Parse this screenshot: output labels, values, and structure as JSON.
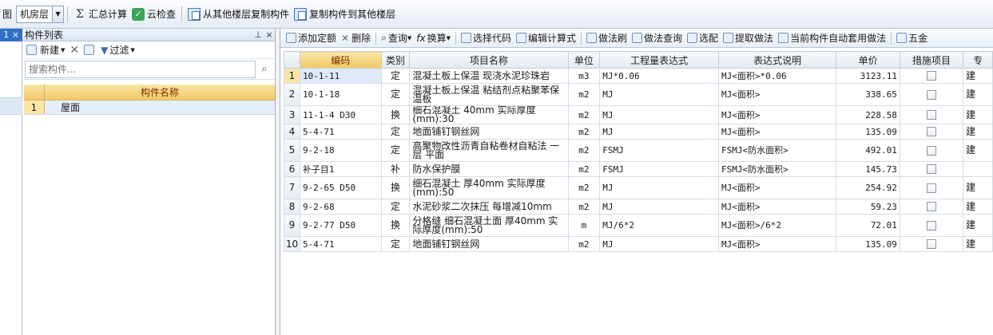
{
  "toolbar": {
    "prefix": "图",
    "floor": "机房层",
    "summary": "汇总计算",
    "cloud_check": "云检查",
    "copy_from_floor": "从其他楼层复制构件",
    "copy_to_floor": "复制构件到其他楼层"
  },
  "left_strip": {
    "tab": "1",
    "close": "×"
  },
  "component_panel": {
    "title": "构件列表",
    "pin": "ᵖ",
    "close": "×",
    "new_label": "新建",
    "filter_label": "过滤",
    "search_placeholder": "搜索构件...",
    "column_header": "构件名称",
    "rows": [
      {
        "index": "1",
        "name": "屋面"
      }
    ]
  },
  "items_toolbar": {
    "add_quota": "添加定额",
    "delete": "删除",
    "query": "查询",
    "convert": "换算",
    "select_code": "选择代码",
    "edit_formula": "编辑计算式",
    "method_brush": "做法刷",
    "method_query": "做法查询",
    "pick": "选配",
    "extract": "提取做法",
    "auto_apply": "当前构件自动套用做法",
    "five_gold": "五金"
  },
  "items_table": {
    "headers": [
      "编码",
      "类别",
      "项目名称",
      "单位",
      "工程量表达式",
      "表达式说明",
      "单价",
      "措施项目",
      "专"
    ],
    "rows": [
      {
        "no": "1",
        "code": "10-1-11",
        "type": "定",
        "name": "混凝土板上保温 现浇水泥珍珠岩",
        "unit": "m3",
        "expr": "MJ*0.06",
        "desc": "MJ<面积>*0.06",
        "price": "3123.11",
        "tail": "建"
      },
      {
        "no": "2",
        "code": "10-1-18",
        "type": "定",
        "name": "混凝土板上保温 粘结剂点粘聚苯保温板",
        "unit": "m2",
        "expr": "MJ",
        "desc": "MJ<面积>",
        "price": "338.65",
        "tail": "建"
      },
      {
        "no": "3",
        "code": "11-1-4 D30",
        "type": "换",
        "name": "细石混凝土 40mm 实际厚度(mm):30",
        "unit": "m2",
        "expr": "MJ",
        "desc": "MJ<面积>",
        "price": "228.58",
        "tail": "建"
      },
      {
        "no": "4",
        "code": "5-4-71",
        "type": "定",
        "name": "地面铺钉钢丝网",
        "unit": "m2",
        "expr": "MJ",
        "desc": "MJ<面积>",
        "price": "135.09",
        "tail": "建"
      },
      {
        "no": "5",
        "code": "9-2-18",
        "type": "定",
        "name": "高聚物改性沥青自粘卷材自粘法 一层 平面",
        "unit": "m2",
        "expr": "FSMJ",
        "desc": "FSMJ<防水面积>",
        "price": "492.01",
        "tail": "建"
      },
      {
        "no": "6",
        "code": "补子目1",
        "type": "补",
        "name": "防水保护膜",
        "unit": "m2",
        "expr": "FSMJ",
        "desc": "FSMJ<防水面积>",
        "price": "145.73",
        "tail": ""
      },
      {
        "no": "7",
        "code": "9-2-65 D50",
        "type": "换",
        "name": "细石混凝土 厚40mm 实际厚度(mm):50",
        "unit": "m2",
        "expr": "MJ",
        "desc": "MJ<面积>",
        "price": "254.92",
        "tail": "建"
      },
      {
        "no": "8",
        "code": "9-2-68",
        "type": "定",
        "name": "水泥砂浆二次抹压 每增减10mm",
        "unit": "m2",
        "expr": "MJ",
        "desc": "MJ<面积>",
        "price": "59.23",
        "tail": "建"
      },
      {
        "no": "9",
        "code": "9-2-77 D50",
        "type": "换",
        "name": "分格缝 细石混凝土面 厚40mm 实际厚度(mm):50",
        "unit": "m",
        "expr": "MJ/6*2",
        "desc": "MJ<面积>/6*2",
        "price": "72.01",
        "tail": "建"
      },
      {
        "no": "10",
        "code": "5-4-71",
        "type": "定",
        "name": "地面铺钉钢丝网",
        "unit": "m2",
        "expr": "MJ",
        "desc": "MJ<面积>",
        "price": "135.09",
        "tail": "建"
      }
    ]
  },
  "colors": {
    "accent": "#2f6fc7",
    "header_gold": "#f2c865",
    "selection": "#e4eefb"
  }
}
